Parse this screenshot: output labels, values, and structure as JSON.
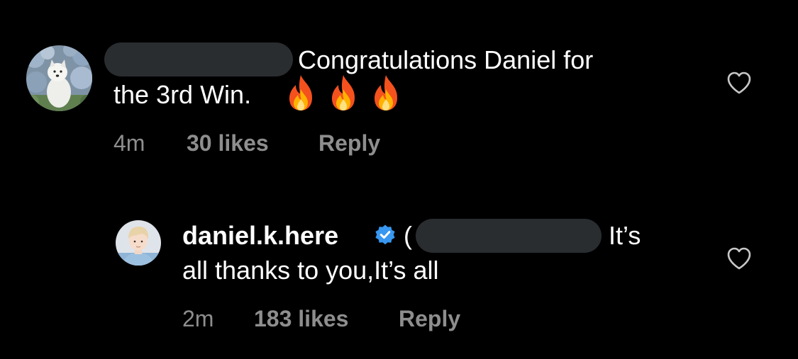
{
  "comments": [
    {
      "username_redacted": true,
      "text_line1": "Congratulations Daniel for",
      "text_line2": "the 3rd Win.",
      "emoji": [
        "fire-emoji",
        "fire-emoji",
        "fire-emoji"
      ],
      "time": "4m",
      "likes": "30 likes",
      "reply": "Reply",
      "avatar": "dog-among-hydrangeas-avatar",
      "like_icon": "heart-outline-icon"
    },
    {
      "username": "daniel.k.here",
      "verified_icon": "verified-badge-icon",
      "mention_open": "(",
      "mention_redacted": true,
      "text_line1_end": "It’s",
      "text_line2": "all thanks to you,It’s all",
      "time": "2m",
      "likes": "183 likes",
      "reply": "Reply",
      "avatar": "person-avatar",
      "like_icon": "heart-outline-icon"
    }
  ],
  "colors": {
    "background": "#000000",
    "text": "#ffffff",
    "meta": "#8e8e8e",
    "redaction": "#2a2d30",
    "verified": "#3897f0"
  }
}
